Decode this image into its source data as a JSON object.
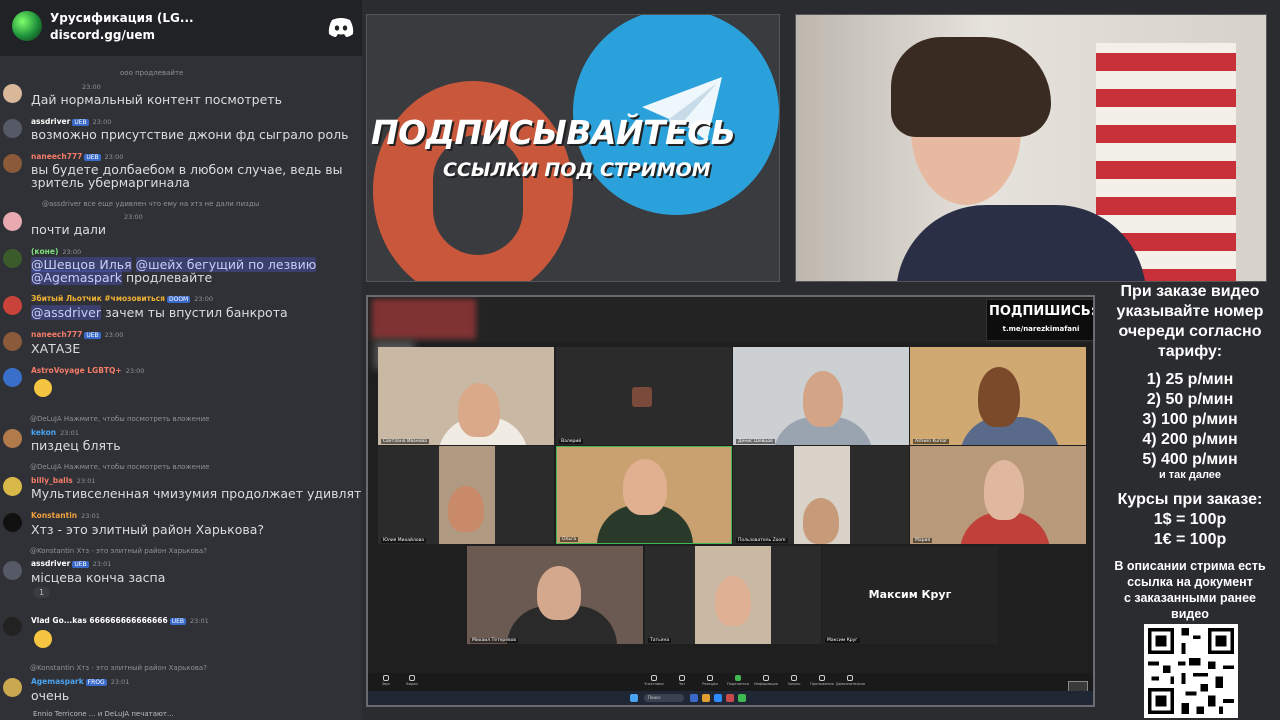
{
  "chat": {
    "server_name": "Урусификация (LG...",
    "server_invite": "discord.gg/uem",
    "discord_icon": "discord-logo-icon",
    "messages": [
      {
        "reply": "ооо продлевайте",
        "user": "",
        "time": "23:00",
        "text": "Дай нормальный контент посмотреть",
        "avatar_color": "#d9b89a"
      },
      {
        "user": "assdriver",
        "tag": "UEB",
        "time": "23:00",
        "text": "возможно присутствие джони фд сыграло роль",
        "avatar_color": "#555a66",
        "user_color": "#ffffff"
      },
      {
        "user": "naneech777",
        "tag": "UEB",
        "time": "23:00",
        "text_line1": "вы будете долбаебом в любом случае, ведь вы",
        "text_line2": "зритель убермаргинала",
        "avatar_color": "#8a5a3a",
        "user_color": "#f47b67"
      },
      {
        "reply": "@assdriver все еще удивлен что ему на хтз не дали пизды",
        "time": "23:00",
        "text": "почти дали",
        "avatar_color": "#e8a9b0"
      },
      {
        "user": "(коне)",
        "time": "23:00",
        "mention1": "@Шевцов Илья",
        "mention2": "@шейх бегущий по лезвию",
        "mention3": "@Agemaspark",
        "text_after": " продлевайте",
        "avatar_color": "#3b5b2a",
        "user_color": "#7ee07e"
      },
      {
        "user": "Збитый Льотчик #чмозовиться",
        "tag": "DOOM",
        "time": "23:00",
        "mention": "@assdriver",
        "text_after": " зачем ты впустил банкрота",
        "avatar_color": "#c9433a",
        "user_color": "#f0b232"
      },
      {
        "user": "naneech777",
        "tag": "UEB",
        "time": "23:00",
        "text": "ХАТАЗЕ",
        "avatar_color": "#8a5a3a",
        "user_color": "#f47b67"
      },
      {
        "user": "AstroVoyage LGBTQ+",
        "time": "23:00",
        "emoji": "grinning-sweat-emoji",
        "avatar_color": "#3a6fc9",
        "user_color": "#f47b67"
      },
      {
        "reply": "Нажмите, чтобы посмотреть вложение",
        "reply_user": "@DeLuJA",
        "user": "kekon",
        "time": "23:01",
        "text": "пиздец блять",
        "avatar_color": "#b07a4a",
        "user_color": "#4aa3f0"
      },
      {
        "reply": "Нажмите, чтобы посмотреть вложение",
        "reply_user": "@DeLuJA",
        "user": "billy_balls",
        "time": "23:01",
        "text": "Мультивселенная чмизумия продолжает удивлять",
        "avatar_color": "#d9b84a",
        "user_color": "#f47b67"
      },
      {
        "user": "Konstantin",
        "time": "23:01",
        "text": "Хтз - это элитный район Харькова?",
        "avatar_color": "#111111",
        "user_color": "#f0a040"
      },
      {
        "reply": "Хтз - это элитный район Харькова?",
        "reply_user": "@Konstantin",
        "user": "assdriver",
        "tag": "UEB",
        "time": "23:01",
        "text": "місцева кончa заспа",
        "reaction": "1",
        "avatar_color": "#555a66",
        "user_color": "#ffffff"
      },
      {
        "user": "Vlad Go...kas 666666666666666",
        "tag": "UEB",
        "time": "23:01",
        "emoji": "joy-emoji",
        "avatar_color": "#222222",
        "user_color": "#ffffff"
      },
      {
        "reply": "Хтз - это элитный район Харькова?",
        "reply_user": "@Konstantin",
        "user": "Agemaspark",
        "tag": "FROG",
        "time": "23:01",
        "text": "очень",
        "avatar_color": "#c9a850",
        "user_color": "#4aa3f0"
      }
    ],
    "typing": "Ennio Terricone ... и DeLuJA печатают..."
  },
  "promo": {
    "title": "ПОДПИСЫВАЙТЕСЬ",
    "subtitle": "ССЫЛКИ ПОД СТРИМОМ",
    "patreon_color": "#c9573b",
    "telegram_color": "#2aa1da"
  },
  "zoom": {
    "subscribe_title": "ПОДПИШИСЬ:",
    "subscribe_link": "t.me/narezkimafani",
    "big_tile_name": "Максим Круг",
    "tiles": [
      {
        "label": "Светлана Иванова"
      },
      {
        "label": "Валерий"
      },
      {
        "label": "Денис Шевцов"
      },
      {
        "label": "Ashwin Kumar"
      },
      {
        "label": "Юлия Михайлова"
      },
      {
        "label": "Ольга"
      },
      {
        "label": "Пользователь Zoom"
      },
      {
        "label": "Мария"
      },
      {
        "label": "Михаил Тетеревов"
      },
      {
        "label": "Татьяна"
      },
      {
        "label": "Максим Круг"
      }
    ],
    "toolbar": [
      "Звук",
      "Видео",
      "Участники",
      "Чат",
      "Реакции",
      "Поделиться",
      "Информация",
      "Запись",
      "Приложения",
      "Дополнительно"
    ],
    "taskbar_search": "Поиск"
  },
  "info": {
    "intro_lines": [
      "При заказе видео",
      "указывайте номер",
      "очереди согласно",
      "тарифу:"
    ],
    "tariffs": [
      "1) 25 р/мин",
      "2) 50 р/мин",
      "3) 100 р/мин",
      "4) 200 р/мин",
      "5) 400 р/мин"
    ],
    "etc": "и так далее",
    "rates_title": "Курсы при заказе:",
    "rates": [
      "1$ = 100р",
      "1€ = 100р"
    ],
    "desc_lines": [
      "В описании стрима есть",
      "ссылка на документ",
      "с заказанными ранее",
      "видео"
    ],
    "qr_icon": "qr-code-icon"
  }
}
